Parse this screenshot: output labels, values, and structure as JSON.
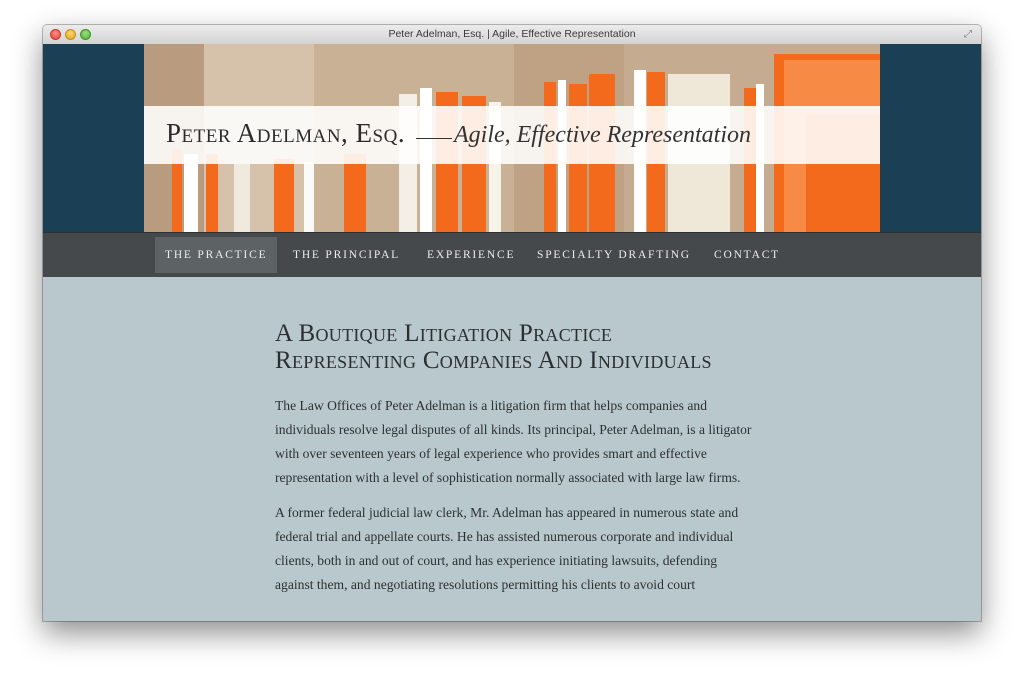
{
  "window": {
    "title": "Peter Adelman, Esq. | Agile, Effective Representation"
  },
  "header": {
    "site_name": "Peter Adelman, Esq.",
    "tagline": "Agile, Effective Representation"
  },
  "nav": {
    "items": [
      {
        "label": "The Practice",
        "active": true
      },
      {
        "label": "The Principal",
        "active": false
      },
      {
        "label": "Experience",
        "active": false
      },
      {
        "label": "Specialty Drafting",
        "active": false
      },
      {
        "label": "Contact",
        "active": false
      }
    ]
  },
  "main": {
    "heading": "A Boutique Litigation Practice Representing Companies And Individuals",
    "paragraphs": [
      "The Law Offices of Peter Adelman is a litigation firm that helps companies and individuals resolve legal disputes of all kinds. Its principal, Peter Adelman, is a litigator with over seventeen years of legal experience who provides smart and effective representation with a level of sophistication normally associated with large law firms.",
      "A former federal judicial law clerk, Mr. Adelman has appeared in numerous state and federal trial and appellate courts. He has assisted numerous corporate and individual clients, both in and out of court, and has experience initiating lawsuits, defending against them, and negotiating resolutions permitting his clients to avoid court"
    ]
  },
  "colors": {
    "header_bg": "#1b3f55",
    "nav_bg": "#45494b",
    "nav_active_bg": "#5d6264",
    "content_bg": "#b9c8cc",
    "folder_orange": "#f46a1c"
  },
  "icons": {
    "close": "window-close-icon",
    "minimize": "window-minimize-icon",
    "maximize": "window-maximize-icon",
    "fullscreen": "fullscreen-icon"
  }
}
